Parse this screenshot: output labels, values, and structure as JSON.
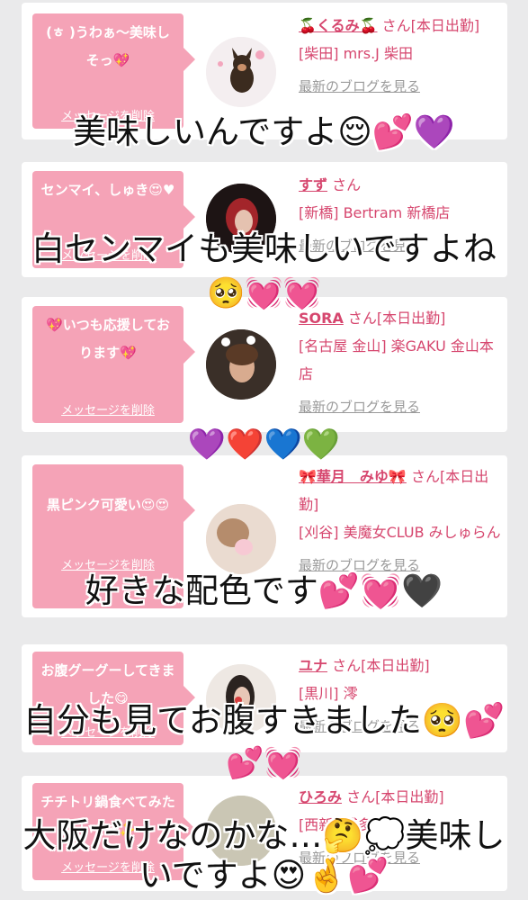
{
  "cards": [
    {
      "message": "(ㅎ )うわぁ〜美味しそっ💖",
      "delete_label": "メッセージを削除",
      "name": "🍒くるみ🍒",
      "honorific": "さん[本日出勤]",
      "shop": "[柴田] mrs.J 柴田",
      "blog_label": "最新のブログを見る"
    },
    {
      "message": "センマイ、しゅき😍♥",
      "delete_label": "メッセージを削除",
      "name": "すず",
      "honorific": "さん",
      "shop": "[新橋] Bertram 新橋店",
      "blog_label": "最新のブログを見る"
    },
    {
      "message": "💖いつも応援しております💖",
      "delete_label": "メッセージを削除",
      "name": "SORA",
      "honorific": "さん[本日出勤]",
      "shop": "[名古屋 金山] 楽GAKU 金山本店",
      "blog_label": "最新のブログを見る"
    },
    {
      "message": "黒ピンク可愛い😍😍",
      "delete_label": "メッセージを削除",
      "name": "🎀華月　みゆ🎀",
      "honorific": "さん[本日出勤]",
      "shop": "[刈谷] 美魔女CLUB みしゅらん",
      "blog_label": "最新のブログを見る"
    },
    {
      "message": "お腹グーグーしてきました😋",
      "delete_label": "メッセージを削除",
      "name": "ユナ",
      "honorific": "さん[本日出勤]",
      "shop": "[黒川] 澪",
      "blog_label": "最新のブログを見る"
    },
    {
      "message": "チチトリ鍋食べてみたいです✨",
      "delete_label": "メッセージを削除",
      "name": "ひろみ",
      "honorific": "さん[本日出勤]",
      "shop": "[西新] 博多大和",
      "blog_label": "最新のブログを見る"
    }
  ],
  "captions": [
    "美味しいんですよ😌💕💜",
    "白センマイも美味しいですよね",
    "🥺💓💓",
    "💜❤️💙💚",
    "好きな配色です💕💓🖤",
    "自分も見てお腹すきました🥺💕",
    "💕💓",
    "大阪だけなのかな…🤔💭美味し",
    "いですよ😍🤞💕"
  ],
  "colors": {
    "background": "#eaeaeb",
    "bubble": "#f5a3b7",
    "name_text": "#d6466e",
    "blog_link": "#9a9a9a"
  }
}
